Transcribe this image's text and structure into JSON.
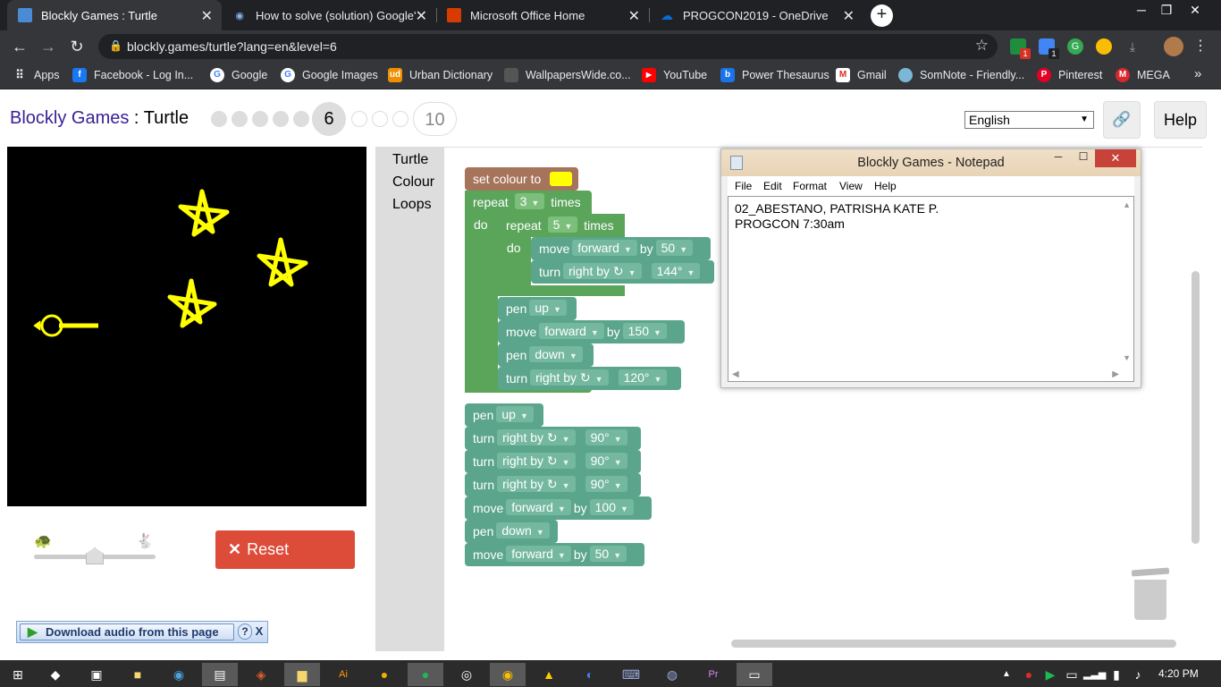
{
  "browser": {
    "tabs": [
      {
        "title": "Blockly Games : Turtle",
        "icon": "puzzle-icon",
        "active": true
      },
      {
        "title": "How to solve (solution) Google's",
        "icon": "eye-icon",
        "active": false
      },
      {
        "title": "Microsoft Office Home",
        "icon": "office-icon",
        "active": false
      },
      {
        "title": "PROGCON2019 - OneDrive",
        "icon": "cloud-icon",
        "active": false
      }
    ],
    "url": "blockly.games/turtle?lang=en&level=6",
    "bookmarks": [
      "Apps",
      "Facebook - Log In...",
      "Google",
      "Google Images",
      "Urban Dictionary",
      "WallpapersWide.co...",
      "YouTube",
      "Power Thesaurus",
      "Gmail",
      "SomNote - Friendly...",
      "Pinterest",
      "MEGA"
    ],
    "extension_badges": [
      "1",
      "1"
    ]
  },
  "app": {
    "brand": "Blockly Games",
    "separator": " : ",
    "game": "Turtle",
    "current_level": "6",
    "max_level": "10",
    "language": "English",
    "help_label": "Help",
    "reset_label": "Reset",
    "download_label": "Download audio from this page",
    "download_help": "?",
    "download_close": "X",
    "toolbox": [
      "Turtle",
      "Colour",
      "Loops"
    ],
    "colors": {
      "brand": "#3b1e95",
      "reset": "#dd4b39",
      "turtle_block": "#5ba58c",
      "loop_block": "#5ba55b",
      "colour_block": "#a5745b",
      "pen_color": "#ffff00"
    },
    "speed_slider": 0.5
  },
  "blocks": {
    "set_colour": "set colour to",
    "repeat": "repeat",
    "times": "times",
    "do": "do",
    "move": "move",
    "turn": "turn",
    "pen": "pen",
    "by": "by",
    "forward": "forward",
    "right_by": "right by ↻",
    "up": "up",
    "down": "down",
    "outer_count": "3",
    "inner_count": "5",
    "v50": "50",
    "v144": "144°",
    "v150": "150",
    "v120": "120°",
    "v90": "90°",
    "v100": "100"
  },
  "notepad": {
    "title": "Blockly Games - Notepad",
    "menus": [
      "File",
      "Edit",
      "Format",
      "View",
      "Help"
    ],
    "lines": [
      "02_ABESTANO, PATRISHA KATE P.",
      "PROGCON 7:30am"
    ]
  },
  "taskbar": {
    "clock": "4:20 PM"
  }
}
